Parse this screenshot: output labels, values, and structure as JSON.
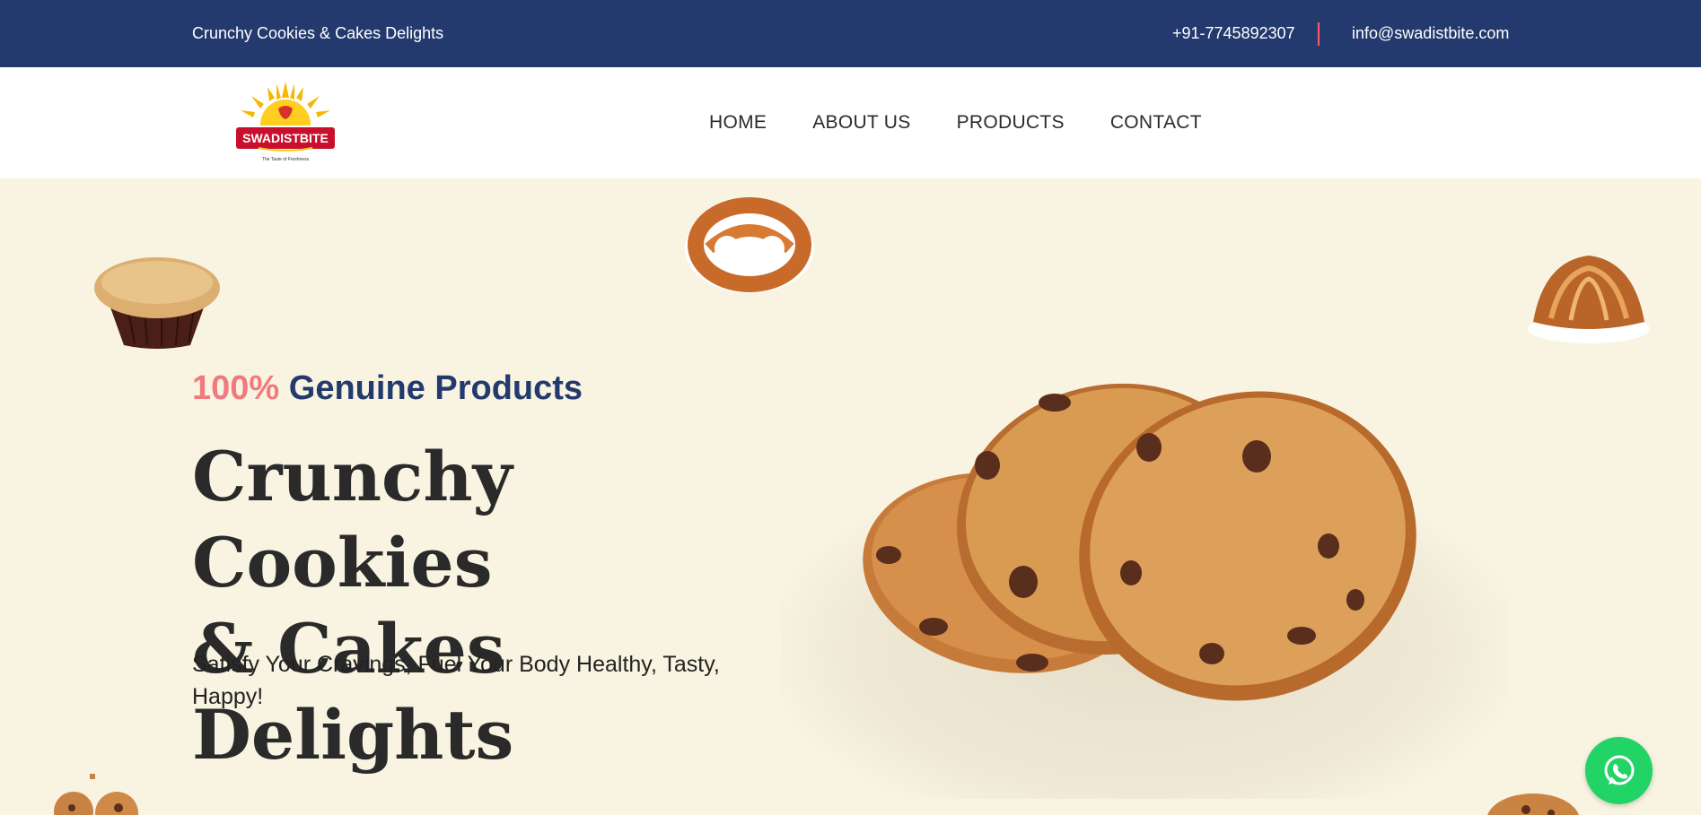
{
  "topbar": {
    "tagline": "Crunchy Cookies & Cakes Delights",
    "phone": "+91-7745892307",
    "email": "info@swadistbite.com"
  },
  "brand": {
    "logo_text": "SWADISTBITE",
    "logo_sub": "The Taste of Freshness"
  },
  "nav": {
    "items": [
      {
        "label": "HOME"
      },
      {
        "label": "ABOUT US"
      },
      {
        "label": "PRODUCTS"
      },
      {
        "label": "CONTACT"
      }
    ]
  },
  "hero": {
    "highlight_pct": "100%",
    "highlight_text": "Genuine Products",
    "title_line1": "Crunchy Cookies",
    "title_line2": "& Cakes Delights",
    "subtitle": "Satisfy Your Cravings, Fuel Your Body Healthy, Tasty, Happy!"
  },
  "colors": {
    "topbar_bg": "#243a6e",
    "hero_bg": "#f8f4e1",
    "accent_pink": "#f07a7f",
    "brand_blue": "#243a6e",
    "whatsapp_green": "#22d366"
  },
  "icons": [
    "muffin-image",
    "pretzel-image",
    "croissant-image",
    "cookies-image",
    "whatsapp-icon"
  ]
}
